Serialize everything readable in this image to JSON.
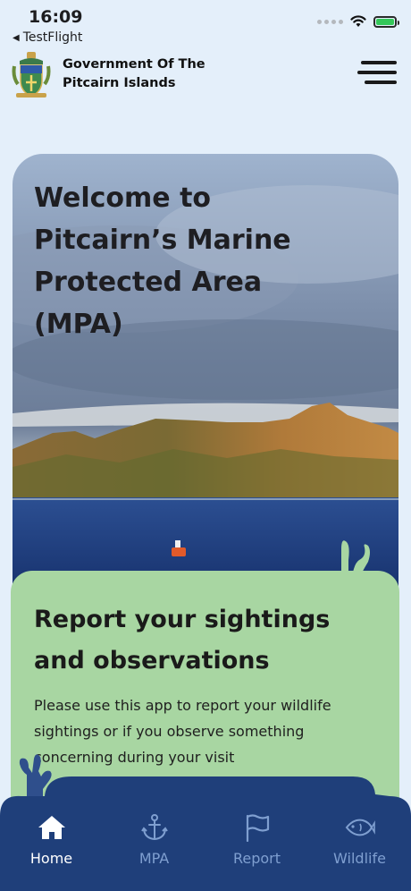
{
  "status_bar": {
    "time": "16:09",
    "back_app": "TestFlight"
  },
  "header": {
    "org_title": "Government Of The Pitcairn Islands"
  },
  "hero": {
    "title": "Welcome to Pitcairn’s Marine Protected Area (MPA)"
  },
  "card": {
    "title": "Report your sightings and observations",
    "body": "Please use this app to report your wildlife sightings or if you observe something concerning during your visit"
  },
  "nav": {
    "items": [
      {
        "label": "Home",
        "icon": "home-icon",
        "active": true
      },
      {
        "label": "MPA",
        "icon": "anchor-icon",
        "active": false
      },
      {
        "label": "Report",
        "icon": "flag-icon",
        "active": false
      },
      {
        "label": "Wildlife",
        "icon": "fish-icon",
        "active": false
      }
    ]
  },
  "colors": {
    "page_bg": "#e4effa",
    "card_green": "#a8d6a2",
    "nav_dark": "#1f3f7a",
    "nav_inactive": "#7f9fd0",
    "coral": "#2f4f8c",
    "battery": "#34c759"
  }
}
